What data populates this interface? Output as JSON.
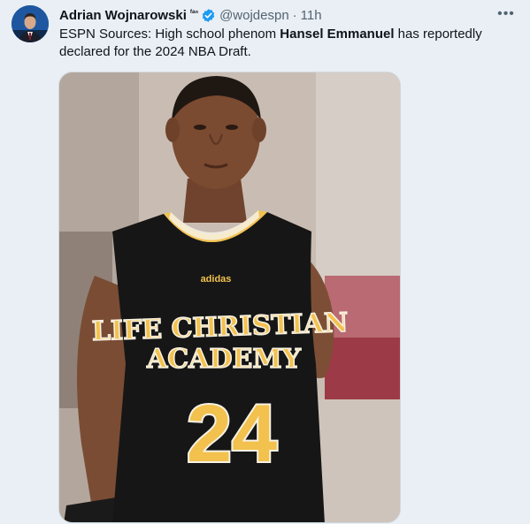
{
  "author": {
    "name": "Adrian Wojnarowski",
    "affiliation": "ᶠᵃⁿ",
    "handle": "@wojdespn",
    "separator": "·",
    "time": "11h",
    "verified": true
  },
  "tweet": {
    "text_prefix": "ESPN Sources: High school phenom ",
    "text_bold": "Hansel Emmanuel",
    "text_suffix": " has reportedly declared for the 2024 NBA Draft."
  },
  "media": {
    "jersey_brand": "adidas",
    "jersey_line1": "LIFE CHRISTIAN",
    "jersey_line2": "ACADEMY",
    "jersey_number": "24"
  },
  "icons": {
    "more": "more-horizontal-icon",
    "verified": "verified-badge-icon"
  },
  "colors": {
    "verified": "#1d9bf0",
    "jersey_gold": "#f2c14e",
    "jersey_black": "#141414"
  }
}
